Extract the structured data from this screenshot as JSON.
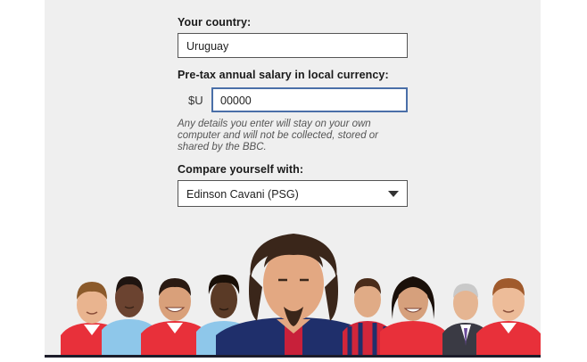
{
  "form": {
    "country_label": "Your country:",
    "country_value": "Uruguay",
    "salary_label": "Pre-tax annual salary in local currency:",
    "currency_symbol": "$U",
    "salary_value": "00000",
    "disclaimer": "Any details you enter will stay on your own computer and will not be collected, stored or shared by the BBC.",
    "compare_label": "Compare yourself with:",
    "compare_value": "Edinson Cavani (PSG)"
  },
  "colors": {
    "panel_bg": "#efefef",
    "field_border": "#555555",
    "focus_border": "#4a6fa8",
    "arsenal_red": "#e8303a",
    "psg_navy": "#1f2f6b",
    "man_city_blue": "#8ec7ea"
  },
  "illustration": {
    "players": [
      "left-player-red-kit",
      "left-player-blue-kit",
      "player-red-kit-smiling",
      "player-blue-kit-curly",
      "cavani-psg-kit",
      "player-striped-kit",
      "player-red-kit-long-hair",
      "manager-suit-grey-hair",
      "player-red-kit-right"
    ]
  }
}
